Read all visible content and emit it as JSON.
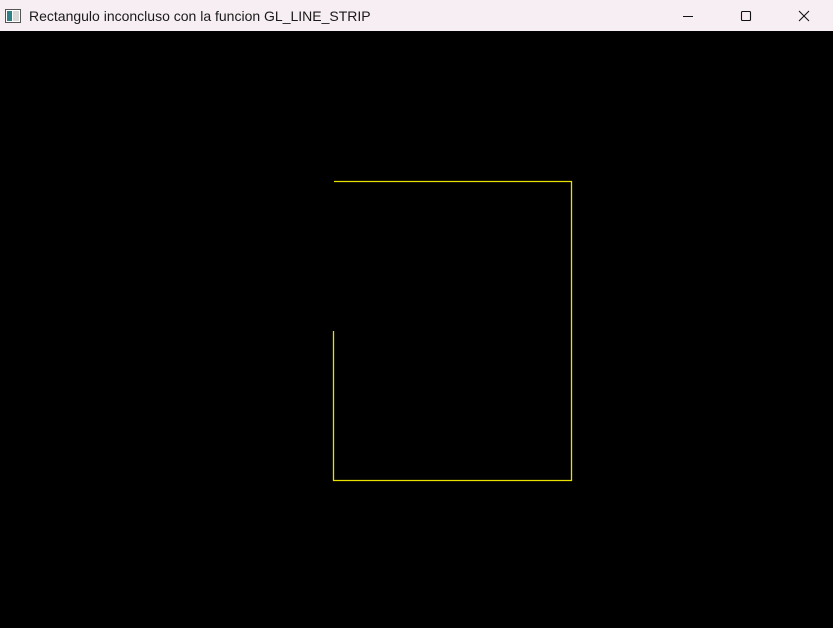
{
  "window": {
    "title": "Rectangulo inconcluso con la funcion GL_LINE_STRIP",
    "app_icon": "opengl-window-icon",
    "controls": [
      "minimize-icon",
      "maximize-icon",
      "close-icon"
    ]
  },
  "canvas": {
    "background": "#000000",
    "line_color": "#e8e000",
    "primitive": "GL_LINE_STRIP"
  }
}
